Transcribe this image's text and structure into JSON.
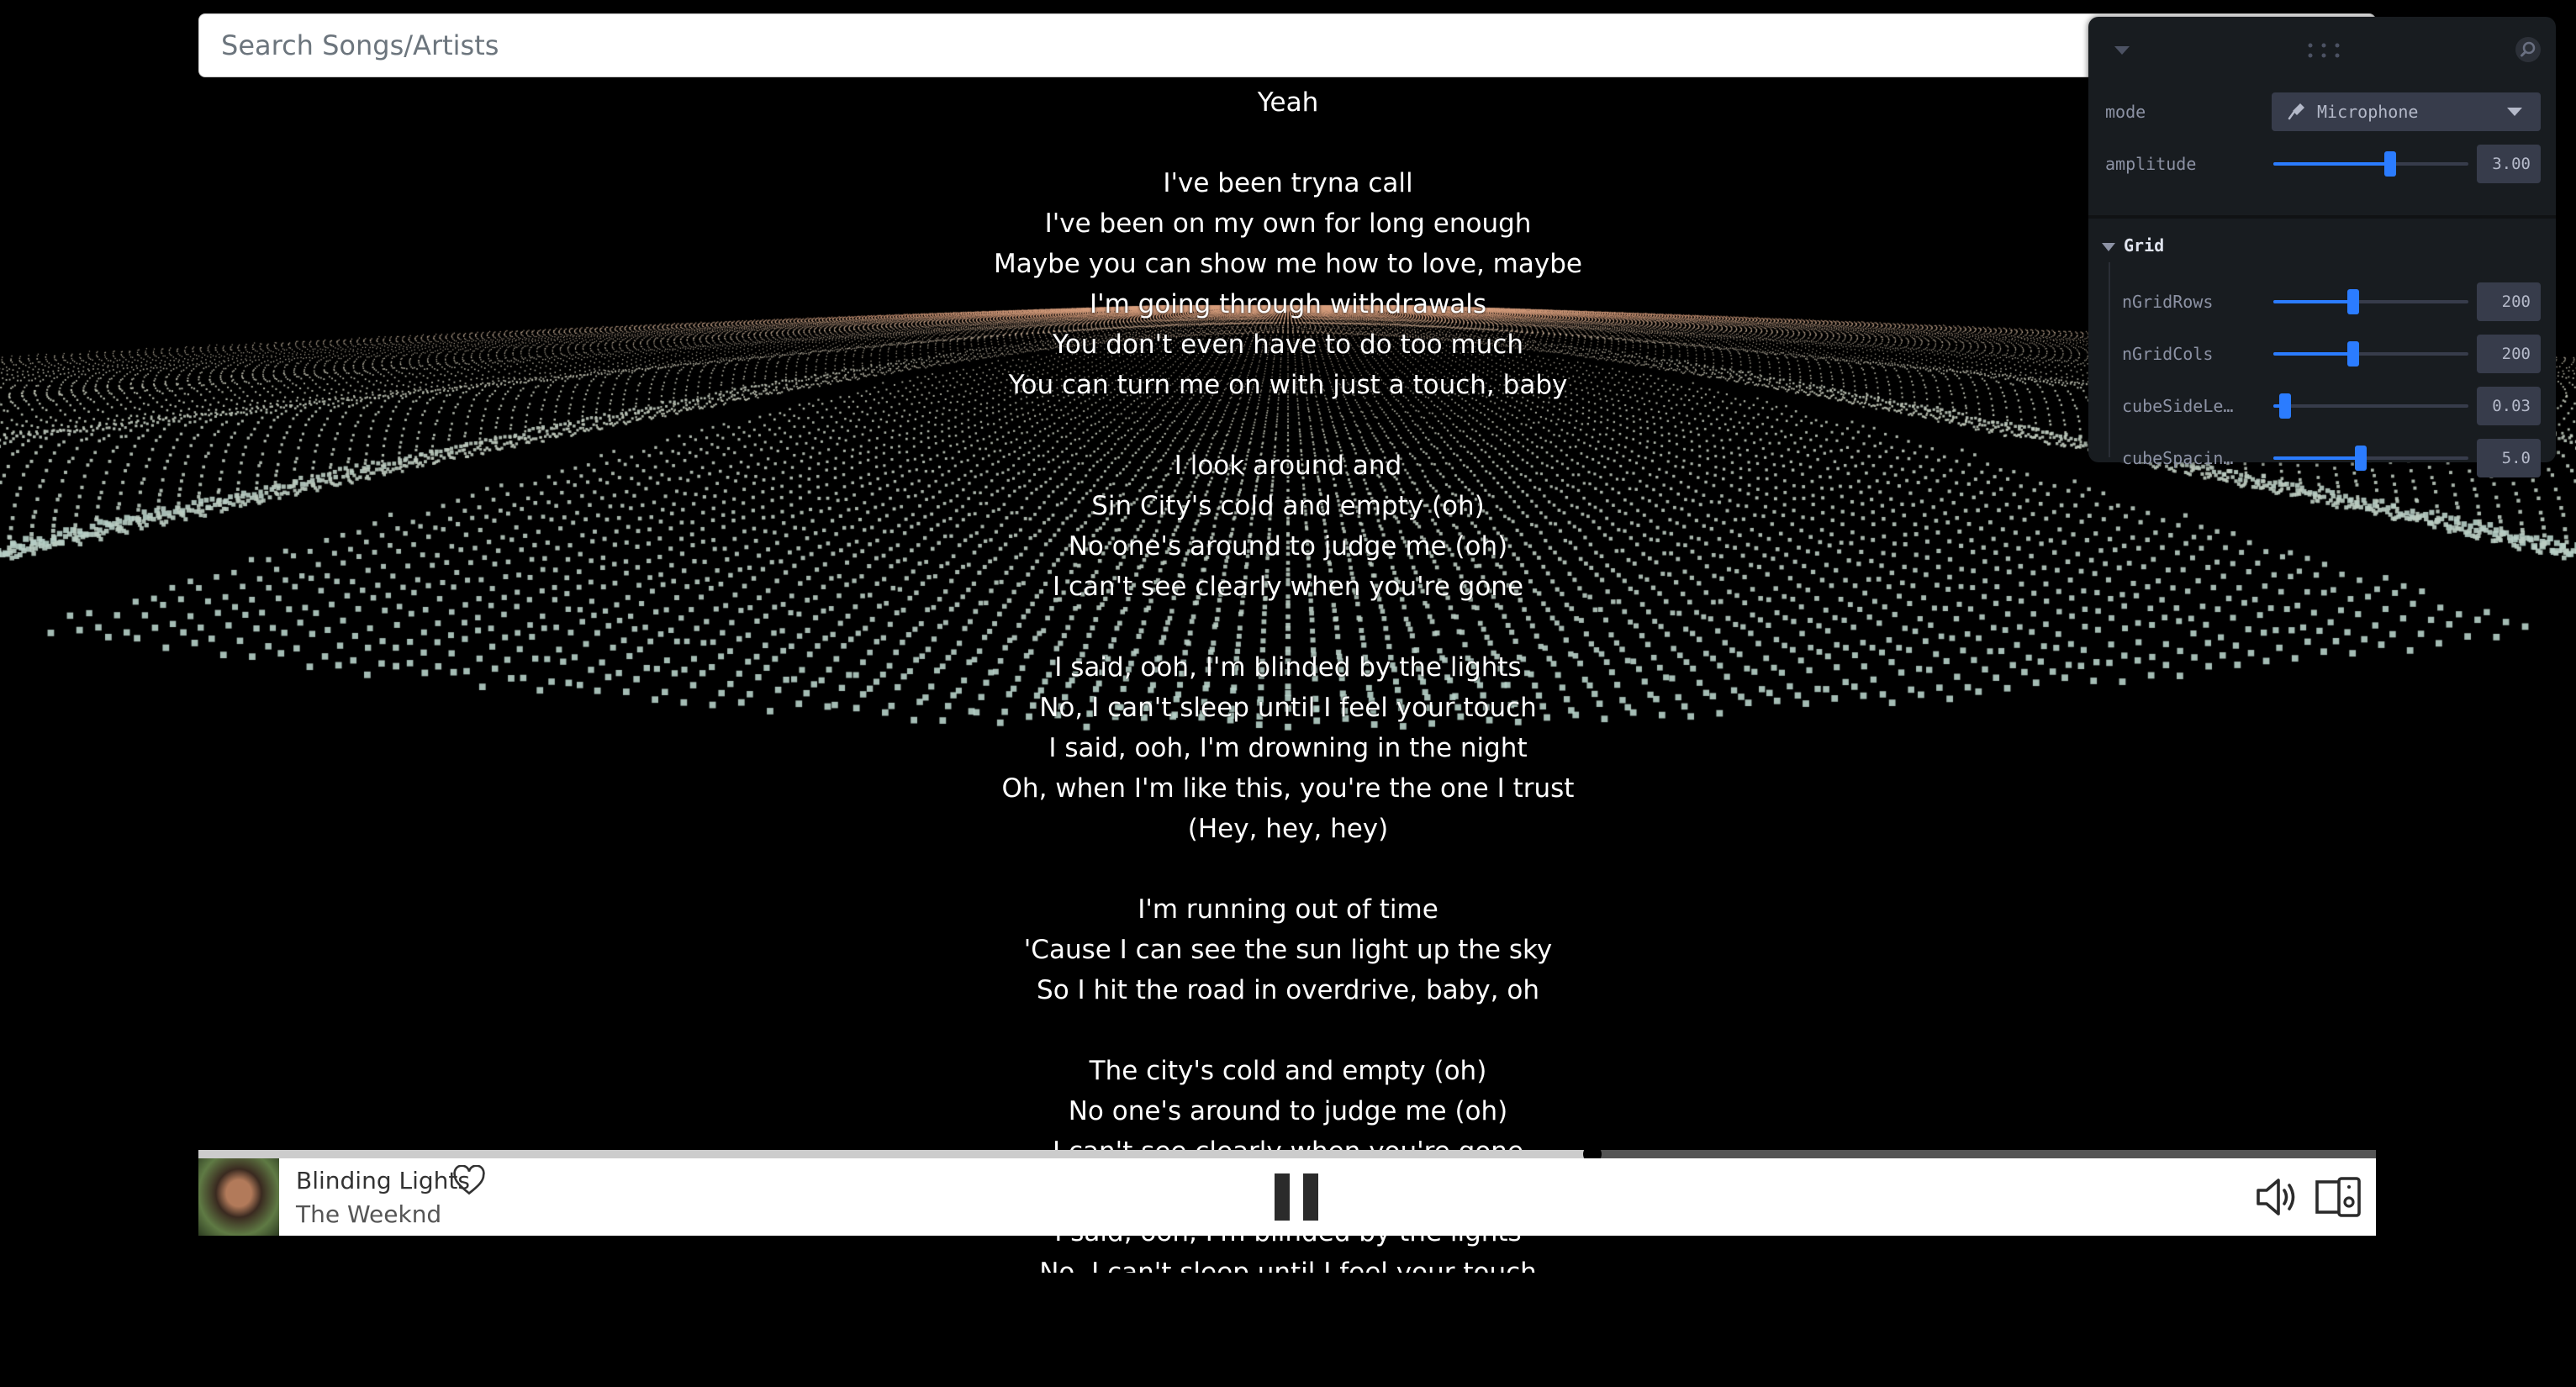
{
  "search": {
    "placeholder": "Search Songs/Artists"
  },
  "lyrics": [
    "Yeah",
    "",
    "I've been tryna call",
    "I've been on my own for long enough",
    "Maybe you can show me how to love, maybe",
    "I'm going through withdrawals",
    "You don't even have to do too much",
    "You can turn me on with just a touch, baby",
    "",
    "I look around and",
    "Sin City's cold and empty (oh)",
    "No one's around to judge me (oh)",
    "I can't see clearly when you're gone",
    "",
    "I said, ooh, I'm blinded by the lights",
    "No, I can't sleep until I feel your touch",
    "I said, ooh, I'm drowning in the night",
    "Oh, when I'm like this, you're the one I trust",
    "(Hey, hey, hey)",
    "",
    "I'm running out of time",
    "'Cause I can see the sun light up the sky",
    "So I hit the road in overdrive, baby, oh",
    "",
    "The city's cold and empty (oh)",
    "No one's around to judge me (oh)",
    "I can't see clearly when you're gone",
    "",
    "I said, ooh, I'm blinded by the lights",
    "No, I can't sleep until I feel your touch"
  ],
  "player": {
    "track_title": "Blinding Lights",
    "artist": "The Weeknd",
    "progress": 0.64,
    "icons": [
      "heart-icon",
      "pause-icon",
      "volume-icon",
      "devices-icon"
    ]
  },
  "gui": {
    "mode_label": "mode",
    "mode_value": "Microphone",
    "amplitude_label": "amplitude",
    "amplitude_value": "3.00",
    "amplitude_fraction": 0.6,
    "folder_title": "Grid",
    "params": [
      {
        "label": "nGridRows",
        "value": "200",
        "fraction": 0.41
      },
      {
        "label": "nGridCols",
        "value": "200",
        "fraction": 0.41
      },
      {
        "label": "cubeSideLe…",
        "value": "0.03",
        "fraction": 0.06
      },
      {
        "label": "cubeSpacin…",
        "value": "5.0",
        "fraction": 0.45
      }
    ]
  },
  "colors": {
    "background": "#000000",
    "particle_near": "#b6d0c8",
    "particle_far": "#d9a07e",
    "gui_bg": "#181c20",
    "gui_accent": "#2b7cff"
  }
}
